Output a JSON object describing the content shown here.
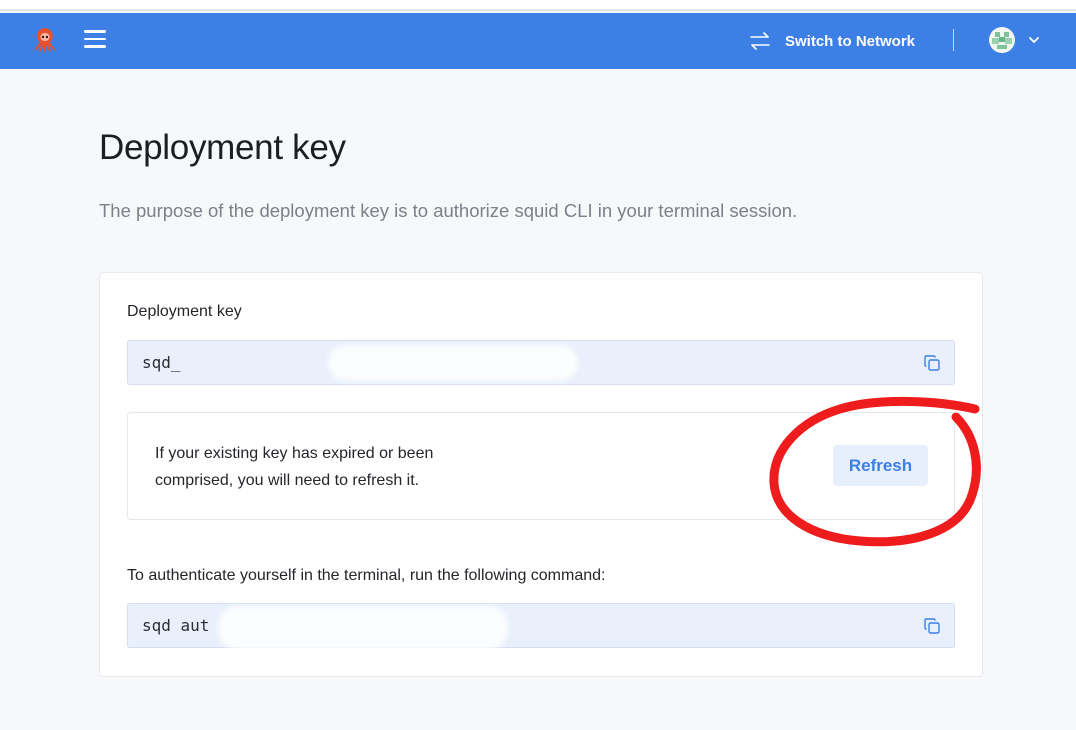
{
  "header": {
    "switch_label": "Switch to Network",
    "logo_icon": "squid-logo-icon",
    "menu_icon": "hamburger-menu-icon",
    "switch_icon": "swap-arrows-icon",
    "avatar_icon": "user-avatar-icon",
    "dropdown_icon": "chevron-down-icon",
    "accent_color": "#3c80e6"
  },
  "page": {
    "title": "Deployment key",
    "description": "The purpose of the deployment key is to authorize squid CLI in your terminal session."
  },
  "card": {
    "key_label": "Deployment key",
    "key_value": "sqd_",
    "refresh_notice": "If your existing key has expired or been comprised, you will need to refresh it.",
    "refresh_button": "Refresh",
    "command_label": "To authenticate yourself in the terminal, run the following command:",
    "command_value": "sqd aut",
    "copy_icon": "copy-icon"
  },
  "annotation": {
    "shape": "red hand-drawn circle around Refresh button",
    "color": "#ee1c1c"
  }
}
